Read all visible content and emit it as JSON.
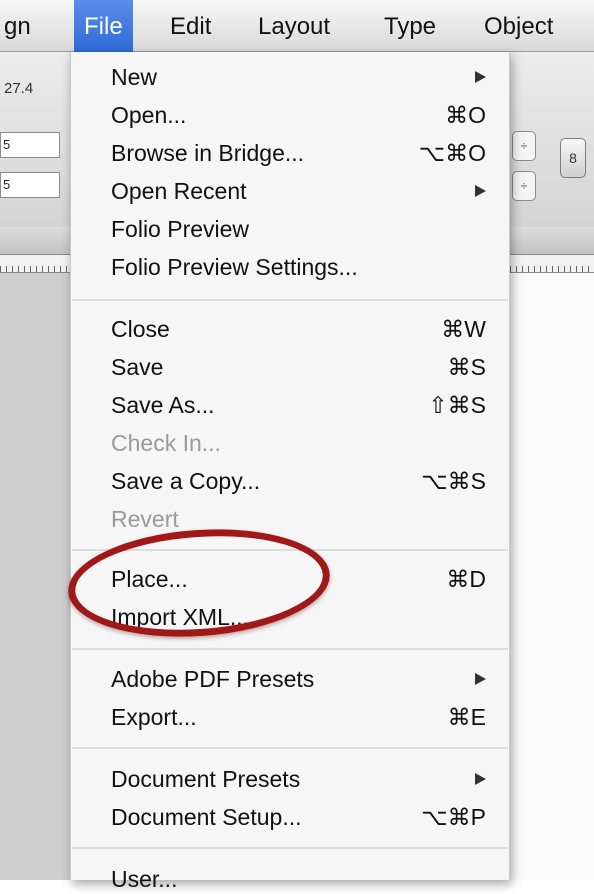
{
  "menubar": {
    "items": [
      "gn",
      "File",
      "Edit",
      "Layout",
      "Type",
      "Object"
    ],
    "active": "File"
  },
  "controlbar": {
    "value_top": "27.4",
    "field_1": "5",
    "field_2": "5",
    "spinner_glyph": "÷",
    "link_glyph": "8"
  },
  "menu": {
    "items": [
      {
        "label": "New",
        "shortcut": "",
        "submenu": true,
        "enabled": true
      },
      {
        "label": "Open...",
        "shortcut": "⌘O",
        "submenu": false,
        "enabled": true
      },
      {
        "label": "Browse in Bridge...",
        "shortcut": "⌥⌘O",
        "submenu": false,
        "enabled": true
      },
      {
        "label": "Open Recent",
        "shortcut": "",
        "submenu": true,
        "enabled": true
      },
      {
        "label": "Folio Preview",
        "shortcut": "",
        "submenu": false,
        "enabled": true
      },
      {
        "label": "Folio Preview Settings...",
        "shortcut": "",
        "submenu": false,
        "enabled": true
      },
      {
        "label": "Close",
        "shortcut": "⌘W",
        "submenu": false,
        "enabled": true
      },
      {
        "label": "Save",
        "shortcut": "⌘S",
        "submenu": false,
        "enabled": true
      },
      {
        "label": "Save As...",
        "shortcut": "⇧⌘S",
        "submenu": false,
        "enabled": true
      },
      {
        "label": "Check In...",
        "shortcut": "",
        "submenu": false,
        "enabled": false
      },
      {
        "label": "Save a Copy...",
        "shortcut": "⌥⌘S",
        "submenu": false,
        "enabled": true
      },
      {
        "label": "Revert",
        "shortcut": "",
        "submenu": false,
        "enabled": false
      },
      {
        "label": "Place...",
        "shortcut": "⌘D",
        "submenu": false,
        "enabled": true
      },
      {
        "label": "Import XML...",
        "shortcut": "",
        "submenu": false,
        "enabled": true
      },
      {
        "label": "Adobe PDF Presets",
        "shortcut": "",
        "submenu": true,
        "enabled": true
      },
      {
        "label": "Export...",
        "shortcut": "⌘E",
        "submenu": false,
        "enabled": true
      },
      {
        "label": "Document Presets",
        "shortcut": "",
        "submenu": true,
        "enabled": true
      },
      {
        "label": "Document Setup...",
        "shortcut": "⌥⌘P",
        "submenu": false,
        "enabled": true
      },
      {
        "label": "User...",
        "shortcut": "",
        "submenu": false,
        "enabled": true
      }
    ]
  },
  "annotation": {
    "color": "#a01817",
    "target": "Place..."
  }
}
